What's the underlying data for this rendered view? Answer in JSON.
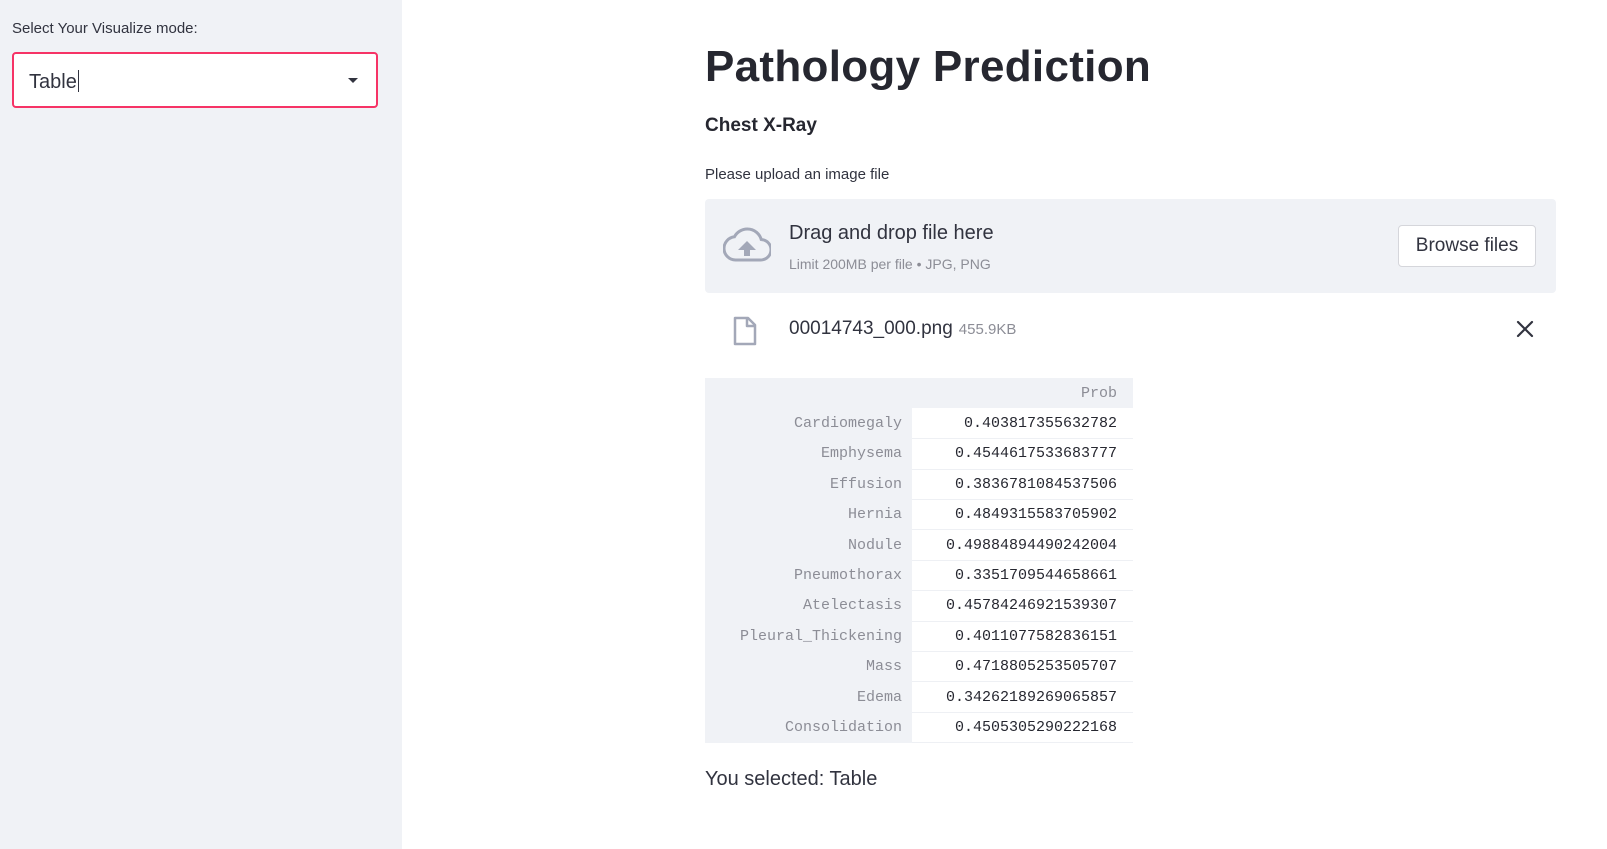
{
  "sidebar": {
    "label": "Select Your Visualize mode:",
    "select": {
      "value": "Table",
      "icon": "chevron-down-icon"
    }
  },
  "main": {
    "title": "Pathology Prediction",
    "subtitle": "Chest X-Ray",
    "upload": {
      "label": "Please upload an image file",
      "dropzone_text": "Drag and drop file here",
      "dropzone_limit": "Limit 200MB per file • JPG, PNG",
      "browse_label": "Browse files",
      "icon": "cloud-upload-icon"
    },
    "file": {
      "name": "00014743_000.png",
      "size": "455.9KB",
      "icon": "file-icon",
      "remove_icon": "close-icon"
    },
    "table": {
      "columns": [
        "Prob"
      ],
      "rows": [
        {
          "label": "Cardiomegaly",
          "prob": "0.403817355632782"
        },
        {
          "label": "Emphysema",
          "prob": "0.4544617533683777"
        },
        {
          "label": "Effusion",
          "prob": "0.3836781084537506"
        },
        {
          "label": "Hernia",
          "prob": "0.4849315583705902"
        },
        {
          "label": "Nodule",
          "prob": "0.49884894490242004"
        },
        {
          "label": "Pneumothorax",
          "prob": "0.3351709544658661"
        },
        {
          "label": "Atelectasis",
          "prob": "0.45784246921539307"
        },
        {
          "label": "Pleural_Thickening",
          "prob": "0.4011077582836151"
        },
        {
          "label": "Mass",
          "prob": "0.4718805253505707"
        },
        {
          "label": "Edema",
          "prob": "0.34262189269065857"
        },
        {
          "label": "Consolidation",
          "prob": "0.4505305290222168"
        }
      ]
    },
    "selected_text": "You selected: Table"
  },
  "colors": {
    "accent": "#f63366",
    "sidebar_bg": "#f0f2f6",
    "text": "#262730",
    "muted": "#8c8d96",
    "icon": "#a3a8b8"
  }
}
